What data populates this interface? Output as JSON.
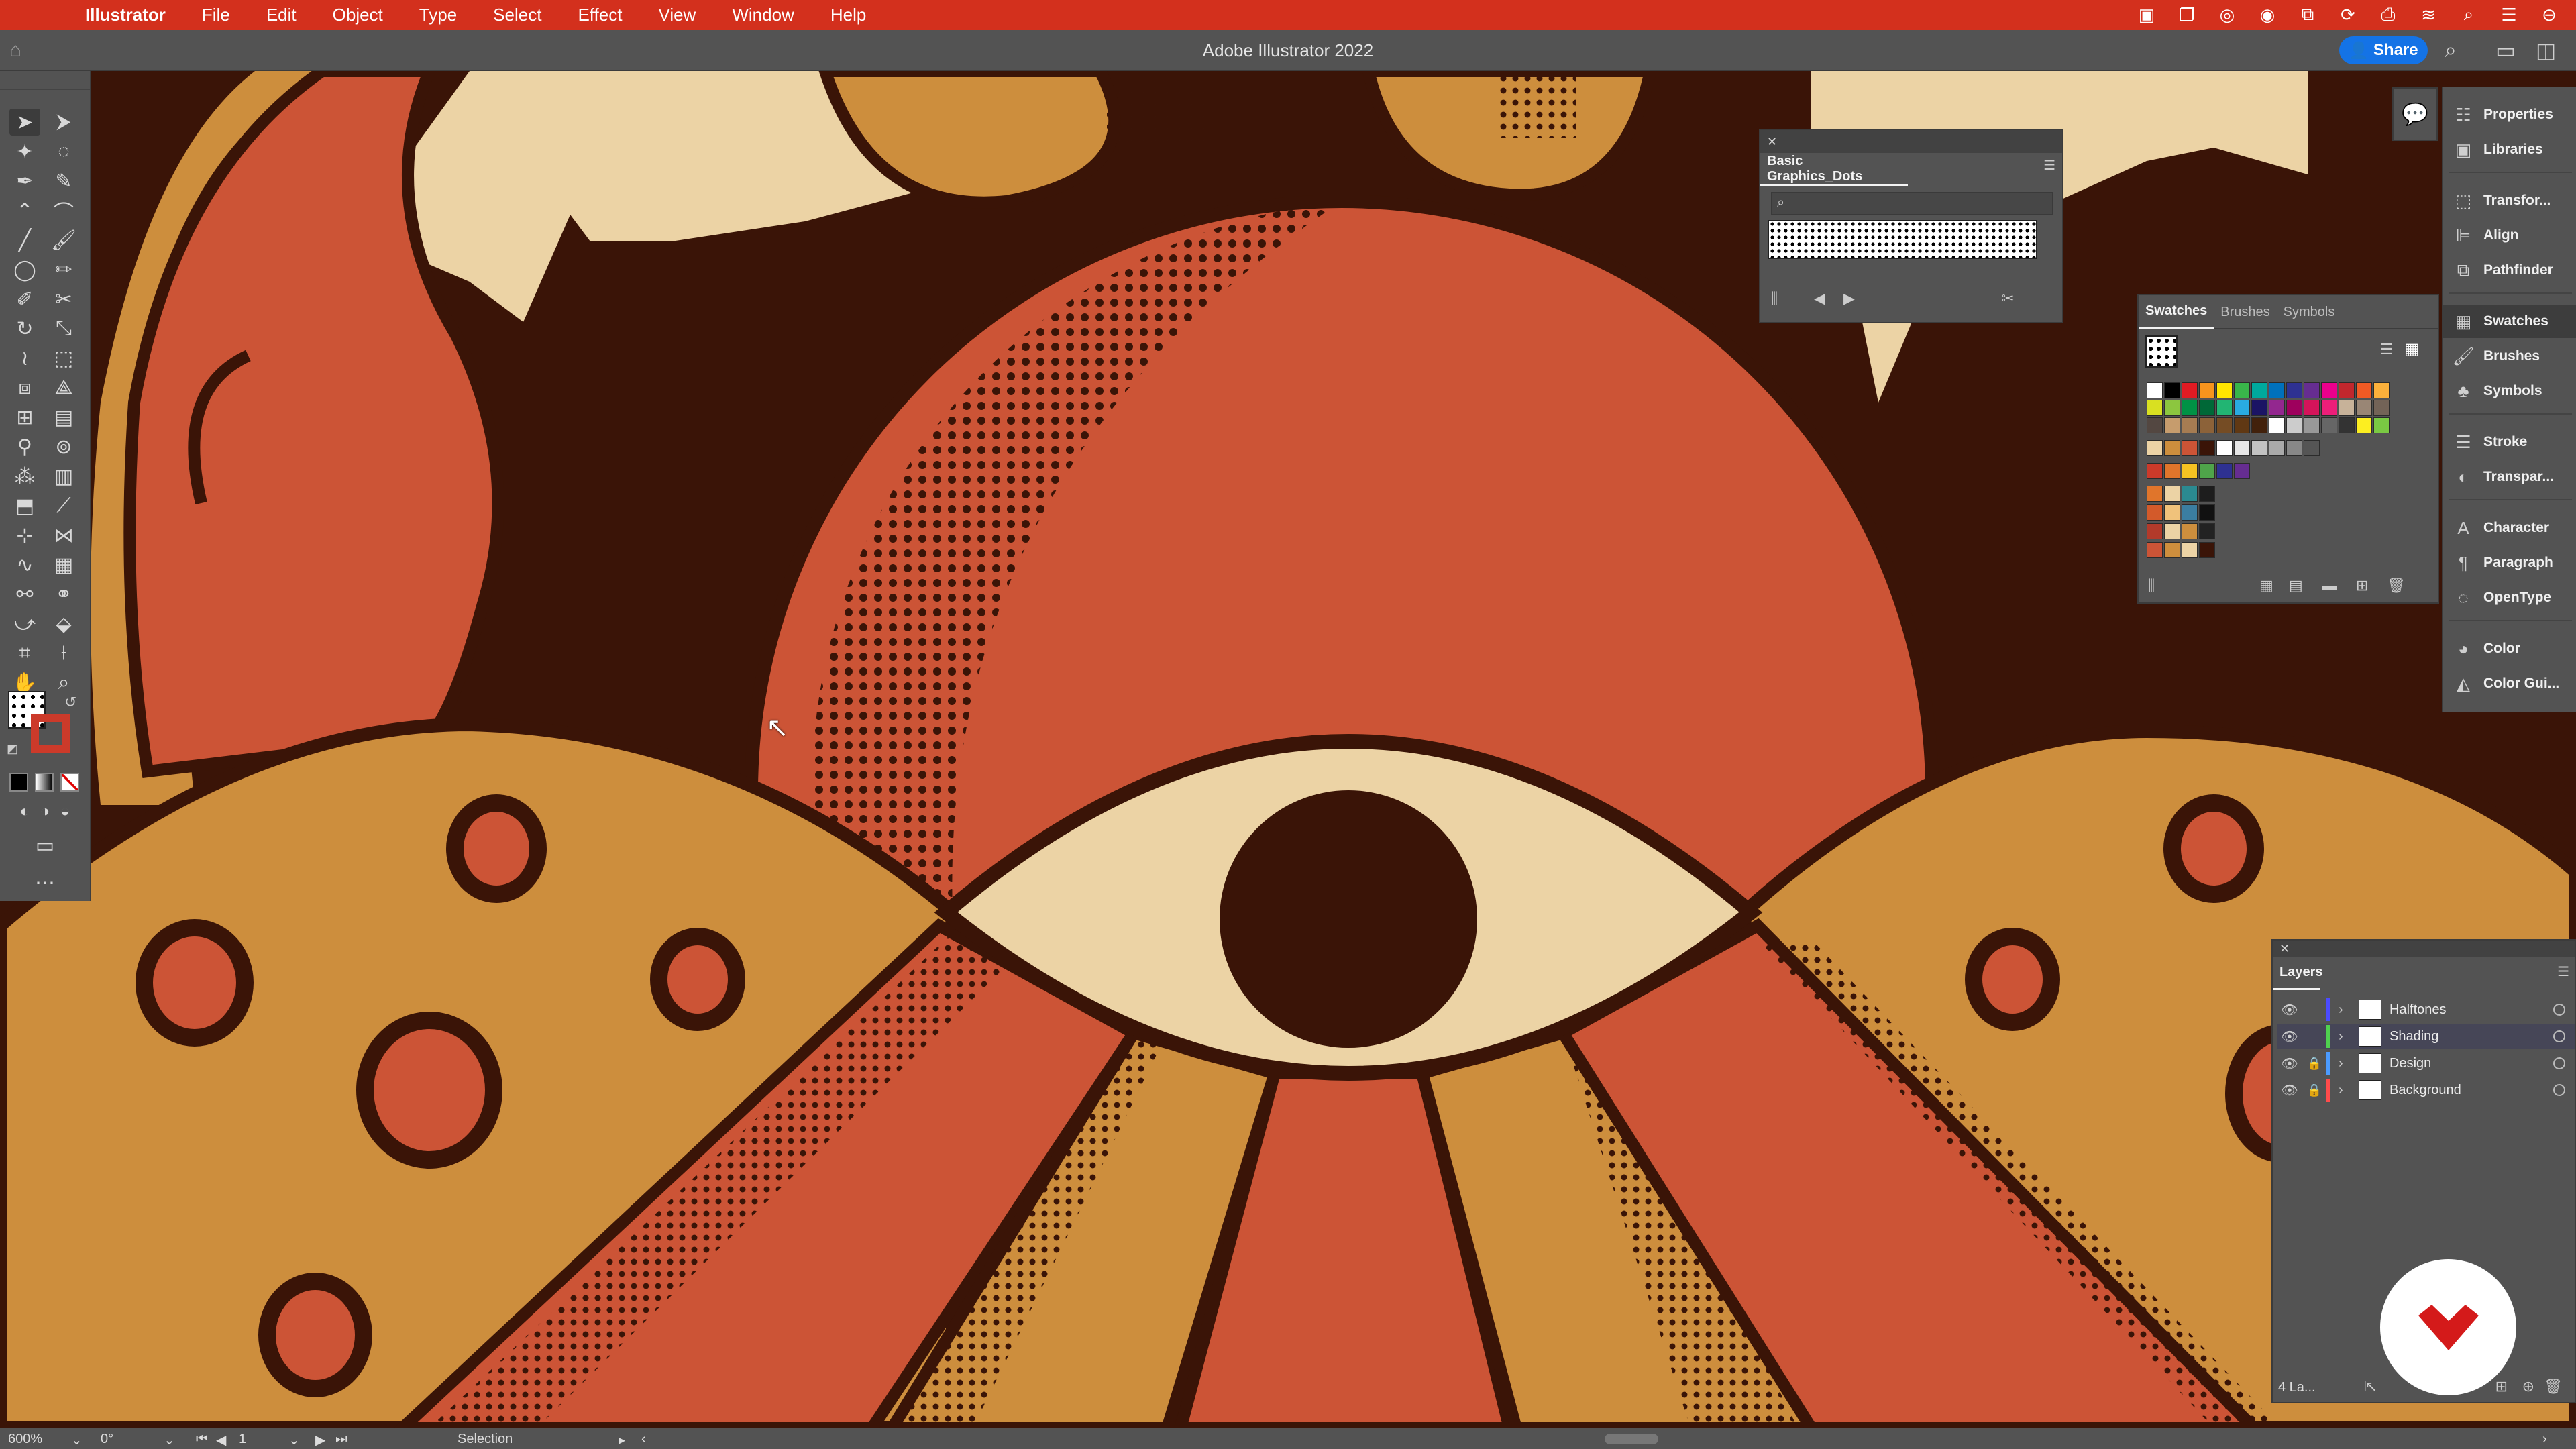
{
  "menubar": {
    "apple_glyph": "",
    "app_name": "Illustrator",
    "items": [
      "File",
      "Edit",
      "Object",
      "Type",
      "Select",
      "Effect",
      "View",
      "Window",
      "Help"
    ]
  },
  "titlebar": {
    "title": "Adobe Illustrator 2022",
    "share_label": "Share"
  },
  "status": {
    "zoom": "600%",
    "rotation": "0°",
    "artboard": "1",
    "tool": "Selection"
  },
  "dots_panel": {
    "title": "Basic Graphics_Dots"
  },
  "swatches_panel": {
    "tabs": [
      "Swatches",
      "Brushes",
      "Symbols"
    ],
    "active_tab": "Swatches"
  },
  "dock": {
    "items": [
      "Properties",
      "Libraries",
      "Transfor...",
      "Align",
      "Pathfinder",
      "Swatches",
      "Brushes",
      "Symbols",
      "Stroke",
      "Transpar...",
      "Character",
      "Paragraph",
      "OpenType",
      "Color",
      "Color Gui..."
    ],
    "active": "Swatches"
  },
  "layers_panel": {
    "title": "Layers",
    "footer_count": "4 La...",
    "layers": [
      {
        "name": "Halftones",
        "color": "#4b4bff",
        "locked": false,
        "active": false
      },
      {
        "name": "Shading",
        "color": "#4fd14f",
        "locked": false,
        "active": true
      },
      {
        "name": "Design",
        "color": "#4b9bff",
        "locked": true,
        "active": false
      },
      {
        "name": "Background",
        "color": "#ff4b4b",
        "locked": true,
        "active": false
      }
    ]
  },
  "colors": {
    "menubar": "#d3301d",
    "dark_brown": "#3a1407",
    "terracotta": "#cc5436",
    "ochre": "#cd8e3d",
    "cream": "#ecd3a5",
    "accent_blue": "#1473e6"
  }
}
